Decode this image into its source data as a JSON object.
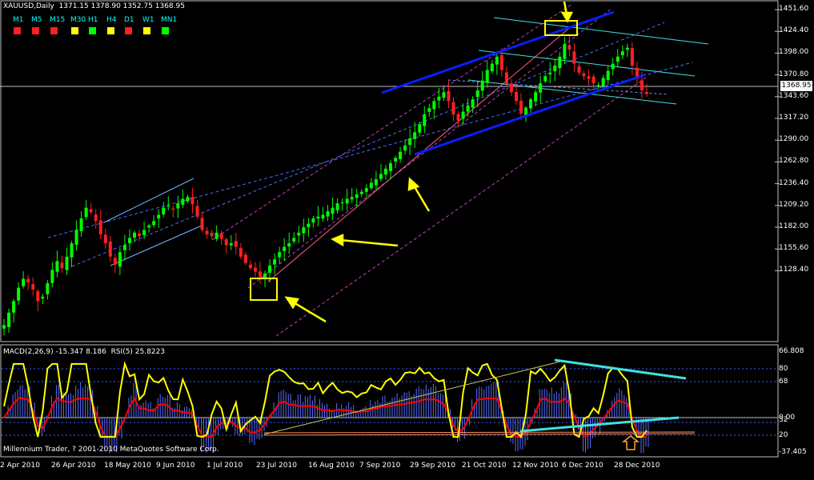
{
  "header": {
    "symbol": "XAUUSD,Daily",
    "ohlc": "1371.15 1378.90 1352.75 1368.95"
  },
  "timeframes": [
    {
      "label": "M1",
      "color": "#ff2020"
    },
    {
      "label": "M5",
      "color": "#ff2020"
    },
    {
      "label": "M15",
      "color": "#ff2020"
    },
    {
      "label": "M30",
      "color": "#ffff00"
    },
    {
      "label": "H1",
      "color": "#00ff00"
    },
    {
      "label": "H4",
      "color": "#ffff00"
    },
    {
      "label": "D1",
      "color": "#ff2020"
    },
    {
      "label": "W1",
      "color": "#ffff00"
    },
    {
      "label": "MN1",
      "color": "#00ff00"
    }
  ],
  "price_axis": [
    "1451.60",
    "1424.40",
    "1398.00",
    "1370.80",
    "1343.60",
    "1317.20",
    "1290.00",
    "1262.80",
    "1236.40",
    "1209.20",
    "1182.00",
    "1155.60",
    "1128.40"
  ],
  "current_price": "1368.95",
  "indicator_label": "MACD(2,26,9) -15.347 8.186  RSI(5) 25.8223",
  "indicator_axis": [
    "66.808",
    "80",
    "68",
    "0.00",
    "32",
    "20",
    "-37.405"
  ],
  "copyright": "Millennium Trader, ? 2001-2010 MetaQuotes Software Corp.",
  "date_labels": [
    "2 Apr 2010",
    "26 Apr 2010",
    "18 May 2010",
    "9 Jun 2010",
    "1 Jul 2010",
    "23 Jul 2010",
    "16 Aug 2010",
    "7 Sep 2010",
    "29 Sep 2010",
    "21 Oct 2010",
    "12 Nov 2010",
    "6 Dec 2010",
    "28 Dec 2010"
  ],
  "colors": {
    "bull": "#00ff00",
    "bear": "#ff2020",
    "rsi": "#ffff00",
    "macd_signal": "#ff0000",
    "histogram": "#5a6cff",
    "channel": "#0000ff",
    "annotation": "#ffff00"
  },
  "chart_data": {
    "type": "candlestick",
    "ylim": [
      1102,
      1462
    ],
    "series": [
      {
        "name": "XAUUSD",
        "values": [
          1108,
          1122,
          1135,
          1150,
          1160,
          1156,
          1148,
          1135,
          1140,
          1155,
          1170,
          1180,
          1172,
          1185,
          1200,
          1215,
          1228,
          1240,
          1235,
          1225,
          1210,
          1200,
          1185,
          1176,
          1190,
          1198,
          1206,
          1212,
          1208,
          1215,
          1220,
          1225,
          1232,
          1240,
          1242,
          1238,
          1245,
          1250,
          1252,
          1244,
          1230,
          1215,
          1210,
          1208,
          1212,
          1205,
          1198,
          1200,
          1196,
          1185,
          1178,
          1172,
          1168,
          1162,
          1166,
          1175,
          1182,
          1190,
          1196,
          1200,
          1206,
          1212,
          1218,
          1222,
          1228,
          1230,
          1232,
          1236,
          1240,
          1245,
          1246,
          1250,
          1252,
          1255,
          1258,
          1262,
          1268,
          1272,
          1278,
          1284,
          1290,
          1296,
          1303,
          1310,
          1318,
          1325,
          1334,
          1345,
          1352,
          1360,
          1365,
          1370,
          1360,
          1345,
          1338,
          1348,
          1355,
          1362,
          1372,
          1383,
          1395,
          1402,
          1410,
          1395,
          1380,
          1370,
          1360,
          1346,
          1352,
          1362,
          1370,
          1380,
          1388,
          1392,
          1400,
          1410,
          1424,
          1418,
          1402,
          1392,
          1388,
          1385,
          1380,
          1378,
          1386,
          1394,
          1402,
          1410,
          1416,
          1420,
          1400,
          1385,
          1372,
          1368
        ]
      }
    ]
  }
}
